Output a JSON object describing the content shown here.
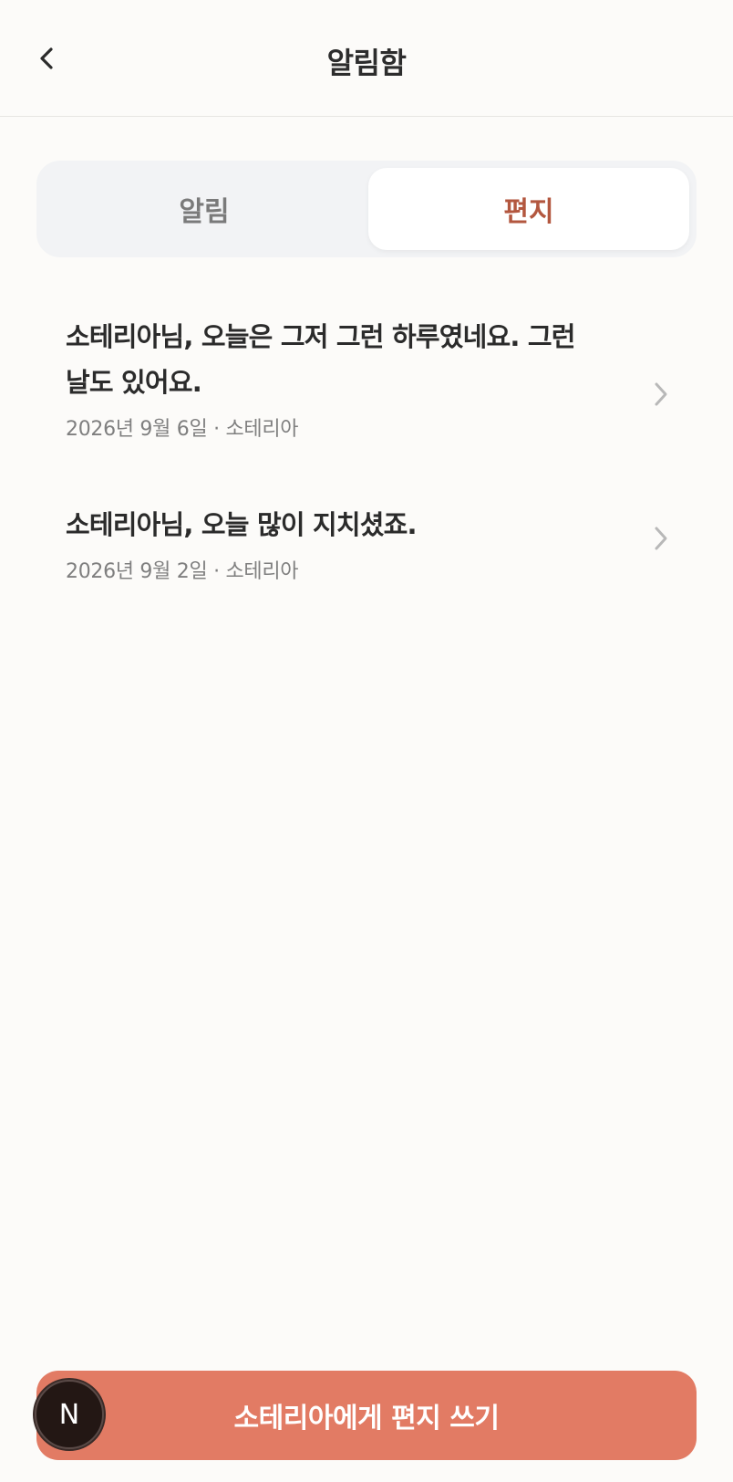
{
  "header": {
    "title": "알림함",
    "back_icon": "chevron-left-icon"
  },
  "tabs": [
    {
      "label": "알림",
      "selected": false
    },
    {
      "label": "편지",
      "selected": true
    }
  ],
  "letters": [
    {
      "title": "소테리아님, 오늘은 그저 그런 하루였네요. 그런 날도 있어요.",
      "meta": "2026년 9월 6일 · 소테리아"
    },
    {
      "title": "소테리아님, 오늘 많이 지치셨죠.",
      "meta": "2026년 9월 2일 · 소테리아"
    }
  ],
  "cta": {
    "label": "소테리아에게 편지 쓰기"
  },
  "avatar": {
    "letter": "N"
  },
  "colors": {
    "accent": "#e27b64",
    "selected_tab_text": "#b3573f",
    "background": "#fcfbf9"
  }
}
